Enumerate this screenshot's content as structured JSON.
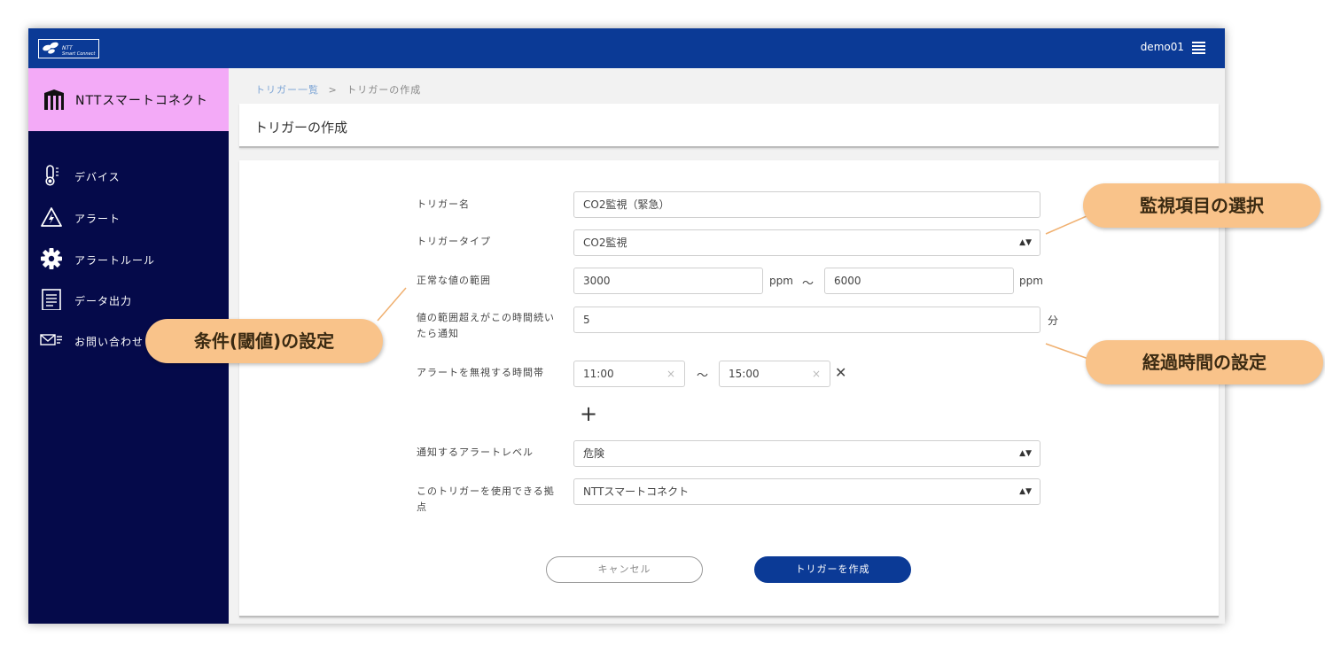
{
  "header": {
    "user": "demo01",
    "logo_text": "NTT Smart Connect"
  },
  "sidebar": {
    "brand": "NTTスマートコネクト",
    "items": [
      {
        "label": "デバイス",
        "icon": "thermometer-icon"
      },
      {
        "label": "アラート",
        "icon": "warning-icon"
      },
      {
        "label": "アラートルール",
        "icon": "gear-icon"
      },
      {
        "label": "データ出力",
        "icon": "document-icon"
      },
      {
        "label": "お問い合わせ",
        "icon": "mail-icon"
      }
    ]
  },
  "breadcrumb": {
    "parent": "トリガー一覧",
    "separator": ">",
    "current": "トリガーの作成"
  },
  "page_title": "トリガーの作成",
  "form": {
    "trigger_name": {
      "label": "トリガー名",
      "value": "CO2監視（緊急）"
    },
    "trigger_type": {
      "label": "トリガータイプ",
      "value": "CO2監視"
    },
    "normal_range": {
      "label": "正常な値の範囲",
      "min": "3000",
      "max": "6000",
      "unit": "ppm",
      "separator": "〜"
    },
    "duration": {
      "label": "値の範囲超えがこの時間続いたら通知",
      "value": "5",
      "unit": "分"
    },
    "ignore_time": {
      "label": "アラートを無視する時間帯",
      "start": "11:00",
      "end": "15:00",
      "separator": "〜"
    },
    "alert_level": {
      "label": "通知するアラートレベル",
      "value": "危険"
    },
    "site": {
      "label": "このトリガーを使用できる拠点",
      "value": "NTTスマートコネクト"
    }
  },
  "buttons": {
    "cancel": "キャンセル",
    "create": "トリガーを作成"
  },
  "callouts": {
    "monitor_item": "監視項目の選択",
    "condition": "条件(閾値)の設定",
    "elapsed_time": "経過時間の設定"
  },
  "colors": {
    "topbar": "#0b3a96",
    "sidebar": "#050a4a",
    "brand_bg": "#f3aaf7",
    "callout": "#f9c38a",
    "primary_button": "#0b3a96"
  }
}
